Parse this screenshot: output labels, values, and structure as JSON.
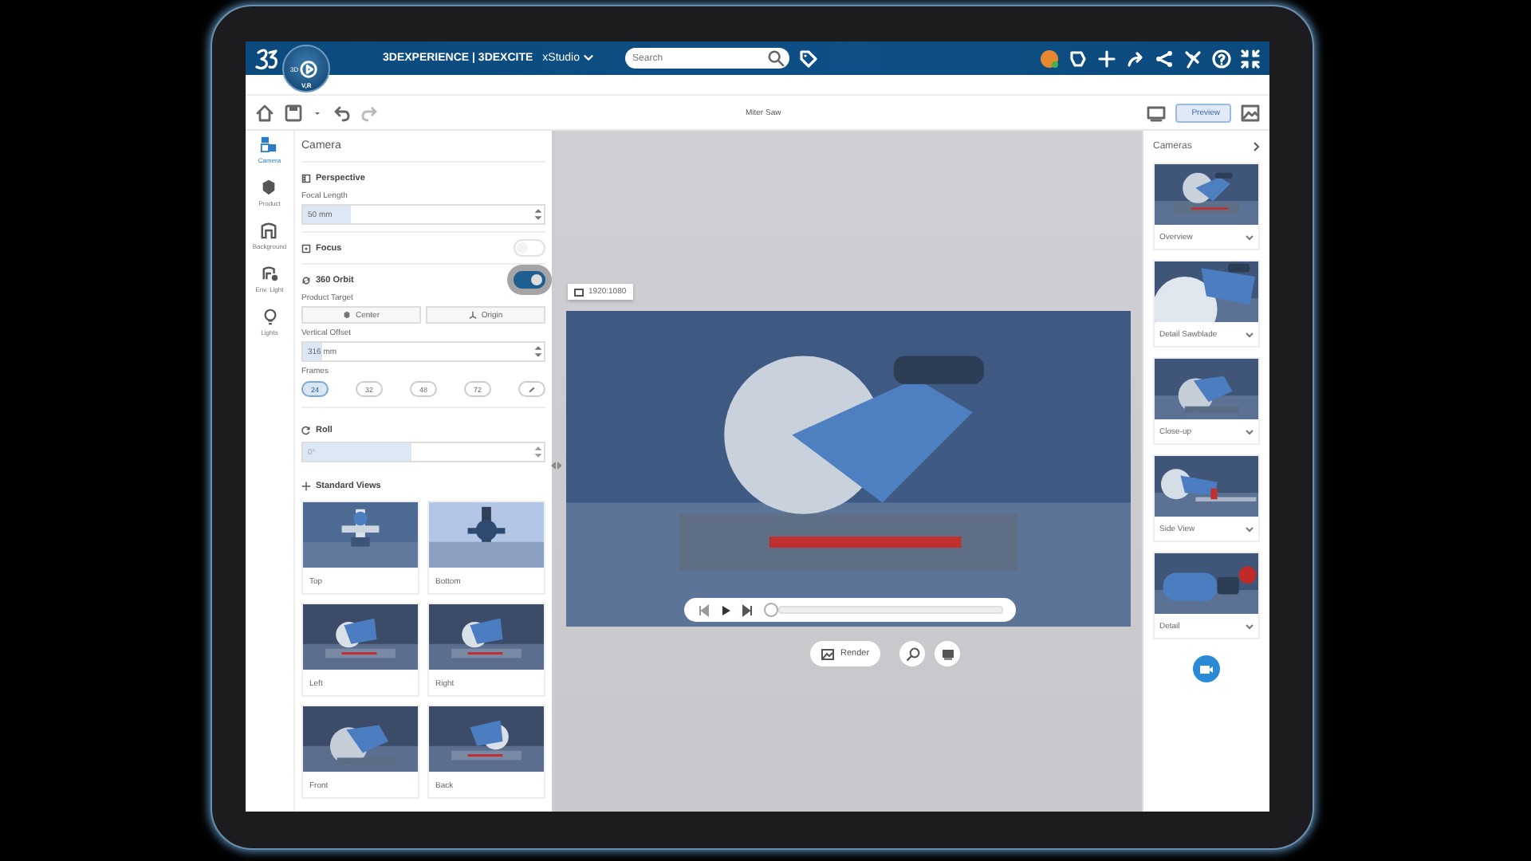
{
  "topbar": {
    "brand": "3DEXPERIENCE | 3DEXCITE",
    "app": "xStudio",
    "search": {
      "placeholder": "Search"
    },
    "compass": {
      "left": "3D",
      "bottom": "V,R"
    }
  },
  "toolbar": {
    "title": "Miter Saw",
    "preview": {
      "label": "Preview",
      "selected": true
    }
  },
  "nav": [
    {
      "label": "Camera",
      "selected": true
    },
    {
      "label": "Product",
      "selected": false
    },
    {
      "label": "Background",
      "selected": false
    },
    {
      "label": "Env. Light",
      "selected": false
    },
    {
      "label": "Lights",
      "selected": false
    }
  ],
  "panel": {
    "title": "Camera",
    "perspective": "Perspective",
    "focal_length": {
      "label": "Focal Length",
      "value": "50 mm",
      "level": 0.2
    },
    "focus": {
      "label": "Focus",
      "on": false
    },
    "orbit": {
      "label": "360 Orbit",
      "on": true
    },
    "product_target": {
      "label": "Product Target",
      "buttons": [
        "Center",
        "Origin"
      ]
    },
    "vertical_offset": {
      "label": "Vertical Offset",
      "value": "316 mm",
      "level": 0.08
    },
    "frames": {
      "label": "Frames",
      "options": [
        {
          "label": "24",
          "selected": true
        },
        {
          "label": "32",
          "selected": false
        },
        {
          "label": "48",
          "selected": false
        },
        {
          "label": "72",
          "selected": false
        }
      ]
    },
    "roll": {
      "label": "Roll",
      "placeholder": "0°",
      "level": 0.45
    },
    "standard_views": {
      "title": "Standard Views",
      "items": [
        {
          "label": "Top"
        },
        {
          "label": "Bottom"
        },
        {
          "label": "Left"
        },
        {
          "label": "Right"
        },
        {
          "label": "Front"
        },
        {
          "label": "Back"
        }
      ]
    }
  },
  "viewport": {
    "resolution": "1920:1080",
    "player": {
      "level": 0
    },
    "render": "Render"
  },
  "cameras": {
    "title": "Cameras",
    "items": [
      {
        "label": "Overview"
      },
      {
        "label": "Detail Sawblade"
      },
      {
        "label": "Close-up"
      },
      {
        "label": "Side View"
      },
      {
        "label": "Detail"
      }
    ]
  }
}
